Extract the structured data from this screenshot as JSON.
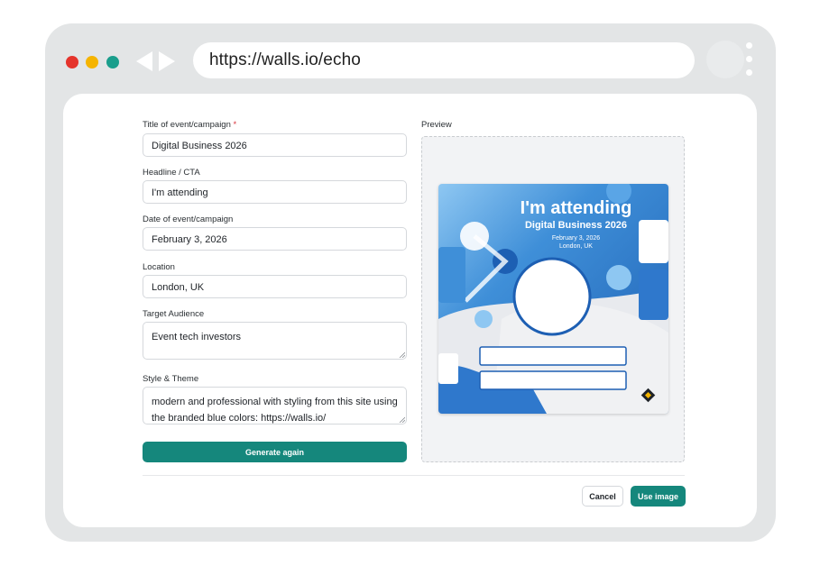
{
  "browser": {
    "url": "https://walls.io/echo",
    "dot_colors": [
      "#e5342c",
      "#f5b400",
      "#1a9e8c"
    ]
  },
  "form": {
    "title_label": "Title of event/campaign",
    "required_mark": "*",
    "title_value": "Digital Business 2026",
    "headline_label": "Headline / CTA",
    "headline_value": "I'm attending",
    "date_label": "Date of event/campaign",
    "date_value": "February 3, 2026",
    "location_label": "Location",
    "location_value": "London, UK",
    "audience_label": "Target Audience",
    "audience_value": "Event tech investors",
    "style_label": "Style & Theme",
    "style_value": "modern and professional with styling from this site using the branded blue colors: https://walls.io/",
    "generate_label": "Generate again"
  },
  "preview": {
    "label": "Preview",
    "headline": "I'm attending",
    "title": "Digital Business 2026",
    "date": "February 3, 2026",
    "location": "London, UK",
    "logo_icon": "walls-logo-icon"
  },
  "footer": {
    "cancel_label": "Cancel",
    "use_label": "Use image"
  },
  "colors": {
    "accent": "#15877c",
    "brand_blue": "#1e6fc0",
    "browser_chrome": "#e3e5e6"
  }
}
